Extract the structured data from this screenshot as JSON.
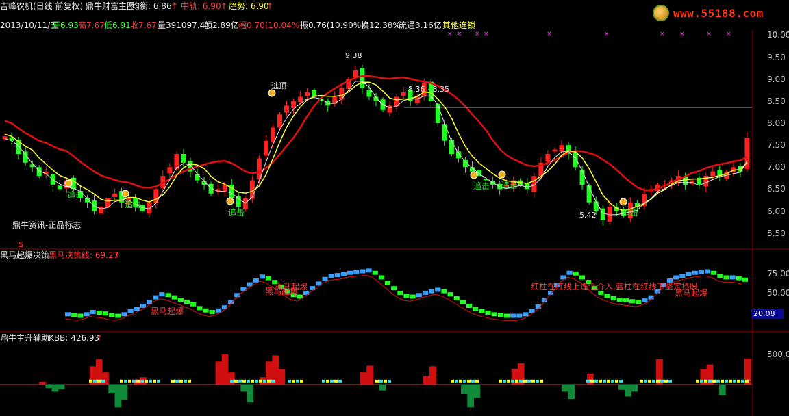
{
  "header": {
    "title": "吉峰农机(日线 前复权) 鼎牛财富主图",
    "avg_label": "均衡: 6.86",
    "mid_label": "中轨: 6.90",
    "trend_label": "趋势: 6.90",
    "up_arrow": "↑"
  },
  "quote": {
    "date": "2013/10/11/五",
    "open": "开6.93",
    "high": "高7.67",
    "low": "低6.91",
    "close": "收7.67",
    "volume": "量391097.4",
    "amount": "额2.89亿",
    "change": "幅0.70(10.04%)",
    "amplitude": "振0.76(10.90%)",
    "turnover": "换12.38%",
    "float": "流通3.16亿",
    "sector": "其他连锁"
  },
  "logo": {
    "site": "www.55188.com",
    "icon": "gold-coin-icon"
  },
  "main_panel": {
    "watermark": "鼎牛资讯-正品标志",
    "top_label": "逃顶",
    "peak_label": "9.38",
    "range_label": "8.36 - 8.35",
    "low_label": "5.42",
    "signals": [
      "追击",
      "追击",
      "追击",
      "追击",
      "追击",
      "追击"
    ],
    "dollar_icon": "$"
  },
  "panel2": {
    "title": "黑马起爆决策",
    "line_label": "黑马决策线: 69.27",
    "signal": "黑马起爆",
    "note": "红柱在红线上逢低介入,蓝柱在红线下坚定持股",
    "current_box": "20.08"
  },
  "panel3": {
    "title": "鼎牛主升辅助",
    "kbb_label": "KBB: 426.93"
  },
  "axes": {
    "main_ticks": [
      "10.00",
      "9.50",
      "9.00",
      "8.50",
      "8.00",
      "7.50",
      "7.00",
      "6.50",
      "6.00",
      "5.50"
    ],
    "panel2_ticks": [
      "75.00",
      "50.00"
    ],
    "panel3_ticks": [
      "500.0"
    ]
  },
  "colors": {
    "up": "#ff2020",
    "down": "#20ff20",
    "yellow": "#ffff33",
    "white": "#e8e8e8",
    "red_band": "#e01010",
    "blue": "#3aa0ff",
    "cyan": "#40e0e0"
  },
  "chart_data": [
    {
      "type": "candlestick",
      "title": "吉峰农机(日线 前复权) 鼎牛财富主图",
      "ylim": [
        5.2,
        10.1
      ],
      "close_path": [
        7.7,
        7.6,
        7.3,
        7.1,
        7.0,
        6.8,
        6.9,
        6.6,
        6.5,
        6.7,
        6.5,
        6.3,
        6.2,
        6.0,
        6.1,
        6.3,
        6.4,
        6.2,
        6.3,
        6.1,
        6.0,
        6.2,
        6.5,
        6.8,
        7.0,
        7.3,
        7.1,
        6.9,
        6.7,
        6.6,
        6.4,
        6.5,
        6.6,
        6.3,
        6.1,
        6.3,
        6.7,
        7.2,
        7.6,
        7.9,
        8.2,
        8.4,
        8.5,
        8.6,
        8.7,
        8.6,
        8.5,
        8.4,
        8.6,
        8.8,
        9.0,
        9.2,
        8.8,
        8.6,
        8.5,
        8.3,
        8.4,
        8.6,
        8.7,
        8.5,
        8.6,
        8.9,
        8.5,
        8.0,
        7.6,
        7.3,
        7.2,
        7.0,
        6.9,
        6.8,
        6.7,
        6.6,
        6.5,
        6.6,
        6.7,
        6.6,
        6.5,
        6.8,
        7.1,
        7.3,
        7.4,
        7.5,
        7.3,
        7.0,
        6.6,
        6.2,
        6.0,
        5.8,
        6.1,
        6.0,
        5.9,
        6.2,
        6.1,
        6.4,
        6.5,
        6.6,
        6.6,
        6.7,
        6.8,
        6.6,
        6.7,
        6.6,
        6.8,
        6.9,
        6.8,
        6.9,
        7.0,
        6.9,
        7.67
      ],
      "peak": 9.38,
      "trough": 5.42,
      "reference_line": 8.36
    },
    {
      "type": "bar",
      "title": "黑马起爆决策",
      "ylim": [
        0,
        90
      ],
      "values": [
        22,
        21,
        20,
        22,
        25,
        24,
        23,
        21,
        20,
        22,
        26,
        29,
        33,
        38,
        44,
        48,
        47,
        44,
        41,
        38,
        35,
        30,
        27,
        25,
        27,
        31,
        38,
        47,
        55,
        61,
        66,
        71,
        69,
        64,
        58,
        52,
        47,
        45,
        50,
        56,
        62,
        68,
        72,
        73,
        74,
        76,
        77,
        78,
        79,
        76,
        70,
        63,
        56,
        50,
        46,
        45,
        47,
        50,
        52,
        54,
        52,
        48,
        43,
        38,
        33,
        29,
        26,
        24,
        22,
        21,
        20,
        20,
        20,
        22,
        26,
        32,
        40,
        50,
        60,
        70,
        76,
        75,
        70,
        64,
        56,
        50,
        46,
        43,
        41,
        40,
        39,
        38,
        40,
        44,
        52,
        60,
        66,
        70,
        72,
        74,
        76,
        77,
        78,
        76,
        72,
        70,
        70,
        69,
        67
      ]
    },
    {
      "type": "area",
      "title": "鼎牛主升辅助",
      "ylim": [
        -500,
        700
      ],
      "values": [
        0,
        0,
        0,
        0,
        0,
        0,
        40,
        -60,
        -120,
        -80,
        0,
        0,
        0,
        0,
        300,
        420,
        200,
        -150,
        -380,
        -250,
        0,
        80,
        120,
        0,
        0,
        0,
        0,
        0,
        0,
        0,
        0,
        0,
        0,
        0,
        380,
        500,
        200,
        0,
        -120,
        -300,
        0,
        120,
        380,
        480,
        260,
        0,
        0,
        0,
        0,
        0,
        0,
        0,
        0,
        0,
        0,
        0,
        0,
        200,
        310,
        0,
        -100,
        0,
        0,
        0,
        0,
        0,
        0,
        140,
        300,
        0,
        0,
        0,
        0,
        -160,
        -380,
        -220,
        0,
        0,
        0,
        0,
        0,
        260,
        350,
        0,
        0,
        0,
        0,
        0,
        0,
        -120,
        -240,
        0,
        0,
        180,
        0,
        0,
        0,
        0,
        -90,
        -200,
        -120,
        0,
        0,
        0,
        420,
        0,
        0,
        0,
        0,
        0,
        0,
        260,
        330,
        0,
        -180,
        0,
        0,
        0,
        430
      ]
    }
  ]
}
